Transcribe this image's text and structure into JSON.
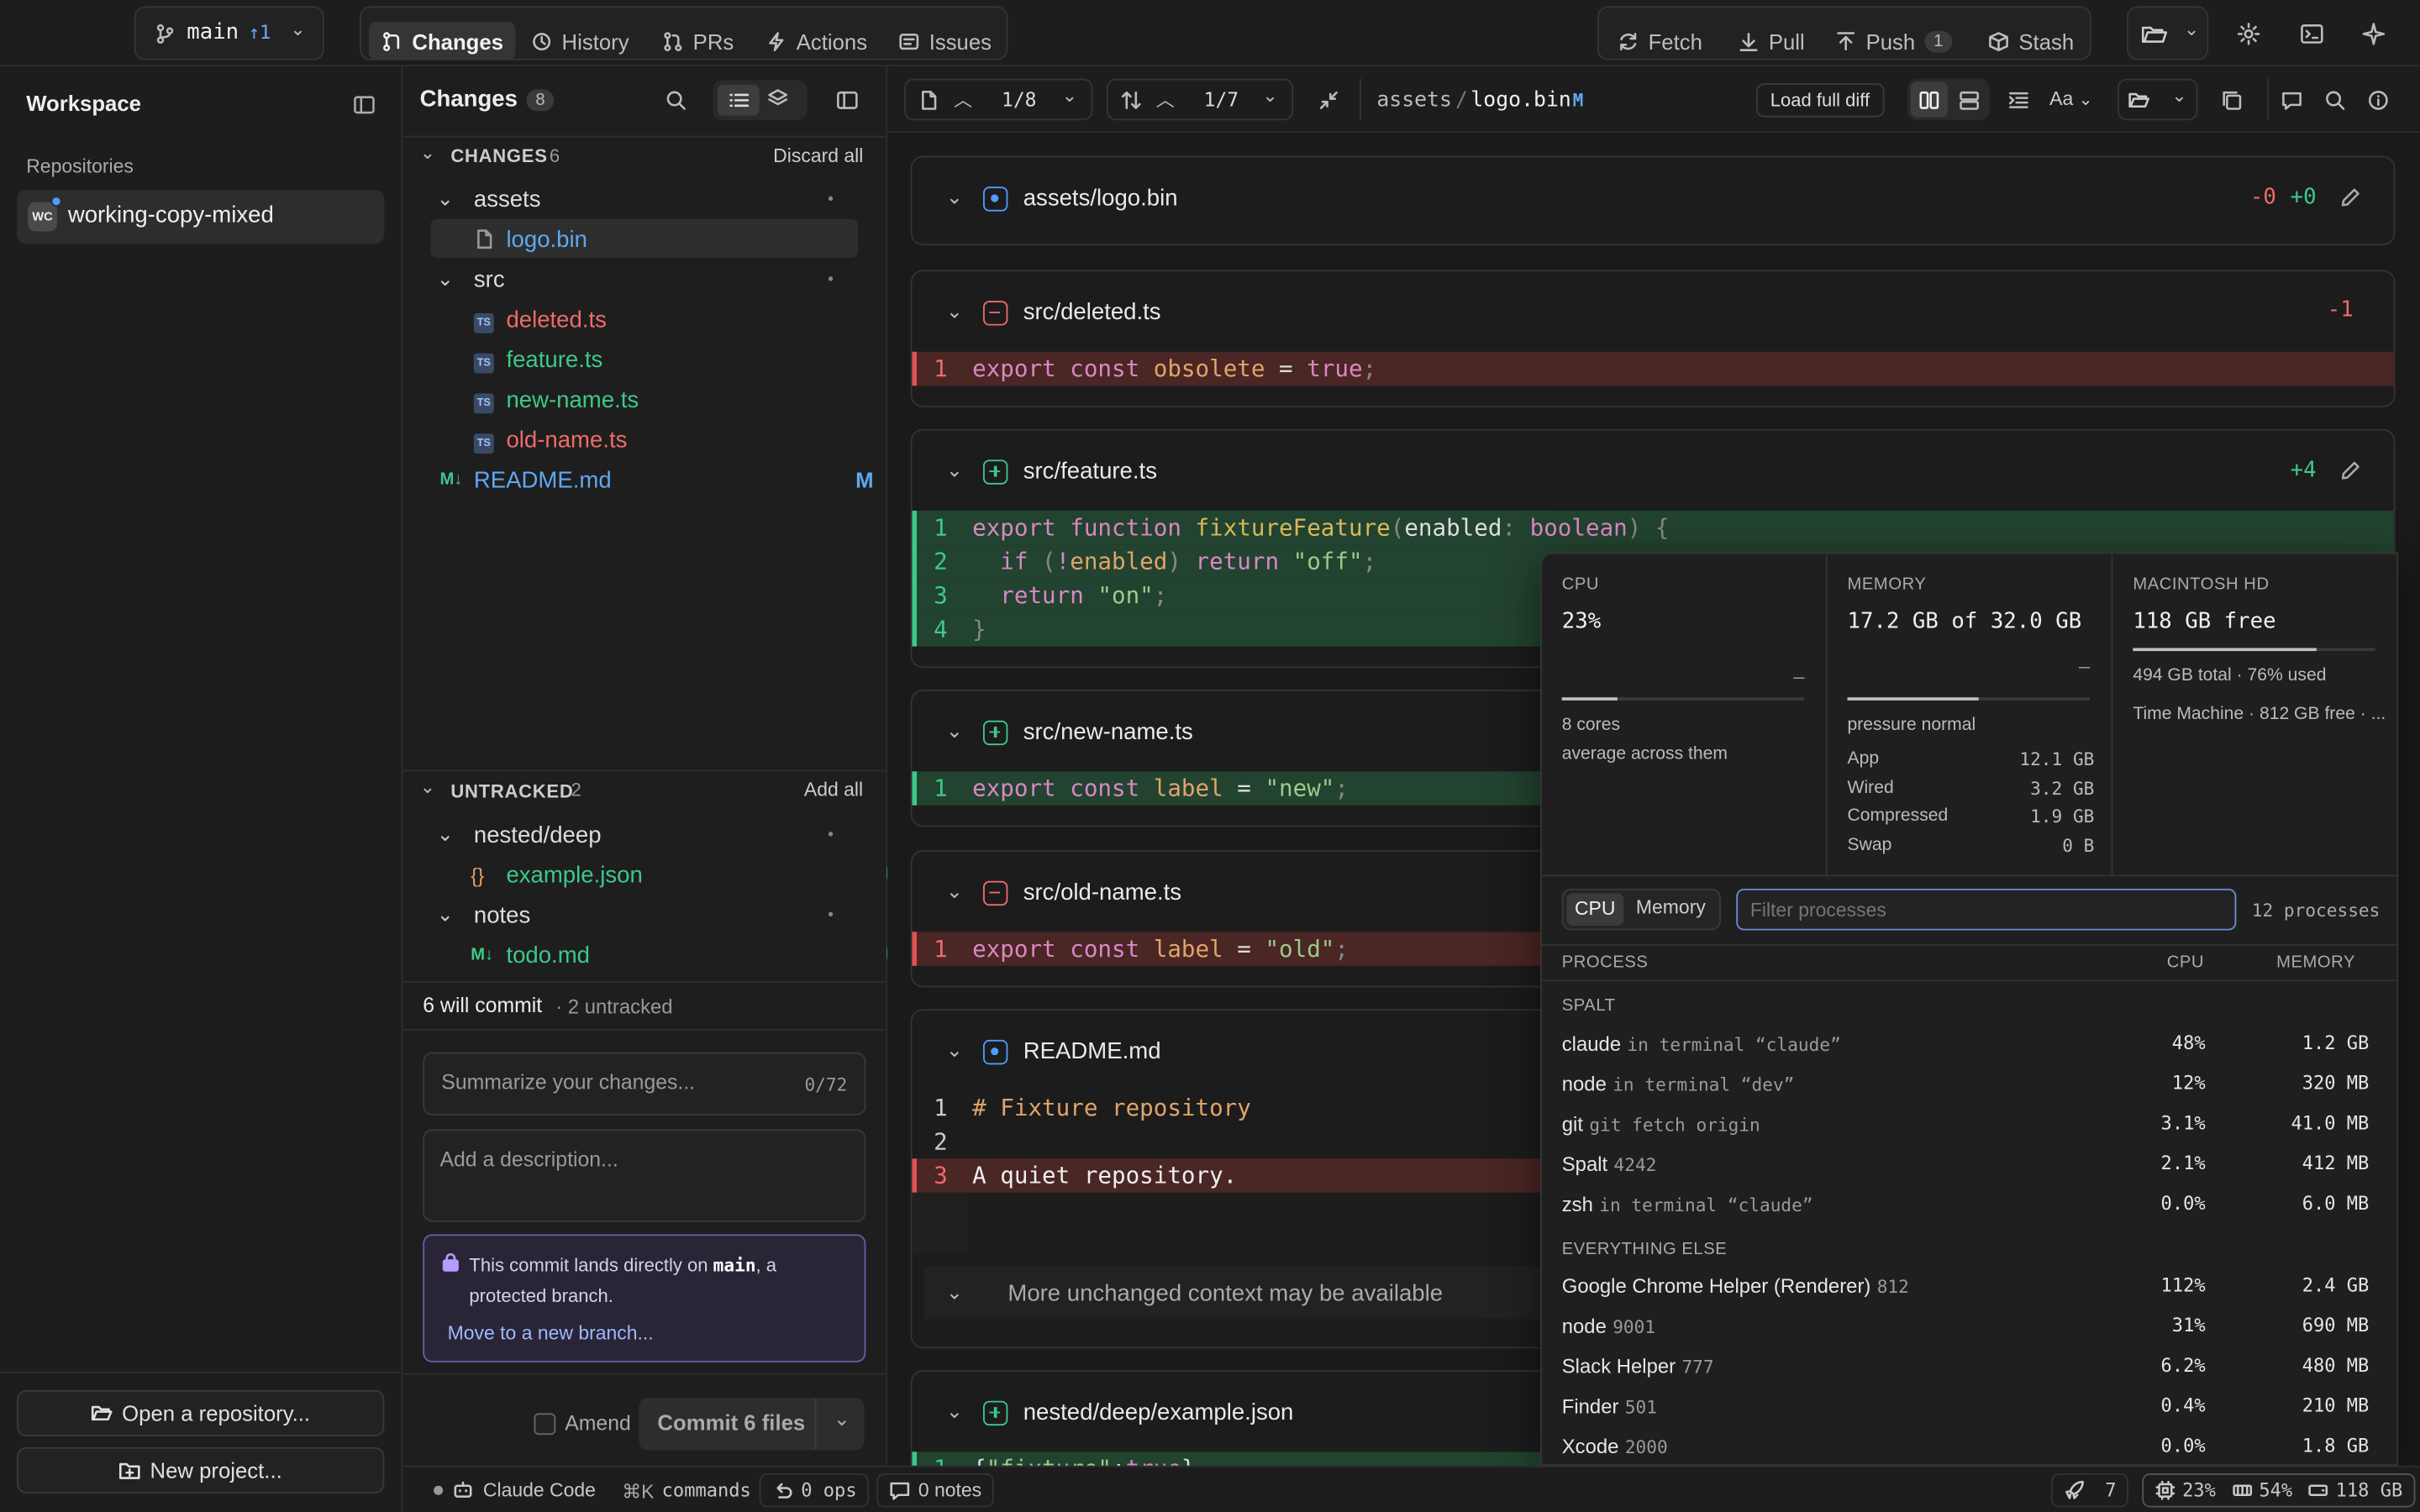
{
  "topbar": {
    "branch": "main",
    "branch_ahead": "↑1",
    "tabs": [
      {
        "label": "Changes",
        "icon": "changes-icon"
      },
      {
        "label": "History",
        "icon": "history-icon"
      },
      {
        "label": "PRs",
        "icon": "pull-request-icon"
      },
      {
        "label": "Actions",
        "icon": "lightning-icon"
      },
      {
        "label": "Issues",
        "icon": "issues-icon"
      }
    ],
    "fetch": "Fetch",
    "pull": "Pull",
    "push": "Push",
    "push_count": "1",
    "stash": "Stash"
  },
  "sidebar": {
    "title": "Workspace",
    "repos_heading": "Repositories",
    "repo_avatar": "WC",
    "repo_name": "working-copy-mixed",
    "open_repo": "Open a repository...",
    "new_project": "New project..."
  },
  "changes": {
    "title": "Changes",
    "count": "8",
    "staged_heading": "CHANGES",
    "staged_count": "6",
    "discard_all": "Discard all",
    "tree": [
      {
        "name": "assets",
        "type": "folder",
        "status": "•"
      },
      {
        "name": "logo.bin",
        "type": "file",
        "status": "M",
        "color": "#5fa8f2"
      },
      {
        "name": "src",
        "type": "folder",
        "status": "•"
      },
      {
        "name": "deleted.ts",
        "type": "ts",
        "status": "D",
        "color": "#f06a6a"
      },
      {
        "name": "feature.ts",
        "type": "ts",
        "status": "A",
        "color": "#3dc98a"
      },
      {
        "name": "new-name.ts",
        "type": "ts",
        "status": "A",
        "color": "#3dc98a"
      },
      {
        "name": "old-name.ts",
        "type": "ts",
        "status": "D",
        "color": "#f06a6a"
      },
      {
        "name": "README.md",
        "type": "md",
        "status": "M",
        "color": "#5fa8f2"
      }
    ],
    "untracked_heading": "UNTRACKED",
    "untracked_count": "2",
    "add_all": "Add all",
    "untracked": [
      {
        "name": "nested/deep",
        "type": "folder",
        "status": "•"
      },
      {
        "name": "example.json",
        "type": "json",
        "status": "U",
        "color": "#3dc98a"
      },
      {
        "name": "notes",
        "type": "folder",
        "status": "•"
      },
      {
        "name": "todo.md",
        "type": "md",
        "status": "U",
        "color": "#3dc98a"
      }
    ],
    "will_commit": "6 will commit",
    "untracked_note": "· 2 untracked",
    "summary_placeholder": "Summarize your changes...",
    "summary_counter": "0/72",
    "description_placeholder": "Add a description...",
    "protected_text_1": "This commit lands directly on",
    "protected_branch": "main",
    "protected_text_2": ", a protected branch.",
    "move_branch": "Move to a new branch...",
    "amend": "Amend",
    "commit_button": "Commit 6 files"
  },
  "diff_header": {
    "file_pos": "1/8",
    "hunk_pos": "1/7",
    "path_dir": "assets",
    "path_sep": "/",
    "path_file": "logo.bin",
    "path_status": "M",
    "load_full_diff": "Load full diff",
    "font_toggle": "Aa"
  },
  "diff": {
    "logo": {
      "file": "assets/logo.bin",
      "minus": "-0",
      "plus": "+0"
    },
    "deleted": {
      "file": "src/deleted.ts",
      "minus": "-1",
      "line_no": "1"
    },
    "feature": {
      "file": "src/feature.ts",
      "plus": "+4"
    },
    "new_name": {
      "file": "src/new-name.ts",
      "line_no": "1"
    },
    "old_name": {
      "file": "src/old-name.ts",
      "line_no": "1"
    },
    "readme": {
      "file": "README.md",
      "line1": "# Fixture repository",
      "line3": "A quiet repository.",
      "more_context": "More unchanged context may be available"
    },
    "example": {
      "file": "nested/deep/example.json"
    }
  },
  "monitor": {
    "cpu_label": "CPU",
    "cpu_value": "23%",
    "cpu_fraction": 0.23,
    "cpu_dash": "–",
    "cpu_cores": "8 cores",
    "cpu_note": "average across them",
    "mem_label": "MEMORY",
    "mem_value": "17.2 GB of 32.0 GB",
    "mem_fraction": 0.54,
    "mem_dash": "–",
    "mem_pressure": "pressure normal",
    "mem_rows": [
      {
        "k": "App",
        "v": "12.1 GB"
      },
      {
        "k": "Wired",
        "v": "3.2 GB"
      },
      {
        "k": "Compressed",
        "v": "1.9 GB"
      },
      {
        "k": "Swap",
        "v": "0 B"
      }
    ],
    "disk_label": "MACINTOSH HD",
    "disk_value": "118 GB free",
    "disk_fraction": 0.76,
    "disk_total": "494 GB total · 76% used",
    "disk_tm": "Time Machine · 812 GB free · ...",
    "seg_cpu": "CPU",
    "seg_memory": "Memory",
    "filter_placeholder": "Filter processes",
    "process_count": "12 processes",
    "col_process": "PROCESS",
    "col_cpu": "CPU",
    "col_memory": "MEMORY",
    "group_spalt": "SPALT",
    "spalt": [
      {
        "name": "claude",
        "sub": "in terminal “claude”",
        "cpu": "48%",
        "mem": "1.2 GB"
      },
      {
        "name": "node",
        "sub": "in terminal “dev”",
        "cpu": "12%",
        "mem": "320 MB"
      },
      {
        "name": "git",
        "sub": "git fetch origin",
        "cpu": "3.1%",
        "mem": "41.0 MB"
      },
      {
        "name": "Spalt",
        "sub": "4242",
        "cpu": "2.1%",
        "mem": "412 MB"
      },
      {
        "name": "zsh",
        "sub": "in terminal “claude”",
        "cpu": "0.0%",
        "mem": "6.0 MB"
      }
    ],
    "group_else": "EVERYTHING ELSE",
    "others": [
      {
        "name": "Google Chrome Helper (Renderer)",
        "sub": "812",
        "cpu": "112%",
        "mem": "2.4 GB"
      },
      {
        "name": "node",
        "sub": "9001",
        "cpu": "31%",
        "mem": "690 MB"
      },
      {
        "name": "Slack Helper",
        "sub": "777",
        "cpu": "6.2%",
        "mem": "480 MB"
      },
      {
        "name": "Finder",
        "sub": "501",
        "cpu": "0.4%",
        "mem": "210 MB"
      },
      {
        "name": "Xcode",
        "sub": "2000",
        "cpu": "0.0%",
        "mem": "1.8 GB"
      }
    ]
  },
  "statusbar": {
    "agent": "Claude Code",
    "commands_key": "⌘K",
    "commands": "commands",
    "ops": "0 ops",
    "notes": "0 notes",
    "rocket_count": "7",
    "cpu": "23%",
    "mem": "54%",
    "disk": "118 GB"
  }
}
